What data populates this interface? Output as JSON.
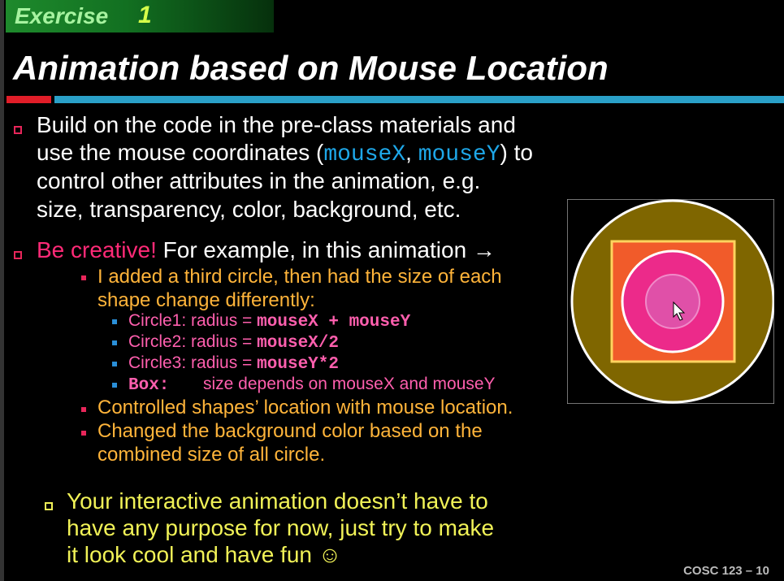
{
  "header": {
    "tag": "Exercise",
    "tag_number": "1",
    "title": "Animation based on Mouse Location"
  },
  "bullet1": {
    "line1": "Build on the code in the pre-class materials and",
    "line2_pre": "use the mouse coordinates (",
    "code1": "mouseX",
    "sep": ", ",
    "code2": "mouseY",
    "line2_post": ") to",
    "line3": "control other attributes in the animation, e.g.",
    "line4": "size, transparency, color, background, etc."
  },
  "bullet2": {
    "highlight": "Be creative!",
    "rest": " For example, in this animation →",
    "sub1_l1": "I added a third circle, then had the size of each",
    "sub1_l2": "shape change differently:",
    "items": [
      {
        "label": "Circle1:  radius = ",
        "code": "mouseX + mouseY"
      },
      {
        "label": "Circle2:  radius = ",
        "code": "mouseX/2"
      },
      {
        "label": "Circle3:  radius = ",
        "code": "mouseY*2"
      },
      {
        "label": "Box:",
        "code": "size depends on mouseX and mouseY"
      }
    ],
    "sub2": "Controlled shapes’ location with mouse location.",
    "sub3_l1": "Changed the background color based on the",
    "sub3_l2": "combined size of all circle."
  },
  "bullet3": {
    "line1": "Your interactive animation doesn’t have to",
    "line2": "have any purpose for now, just try to make",
    "line3": "it look cool and have fun ☺"
  },
  "footer": "COSC 123 – 10",
  "colors": {
    "accent_red": "#e01d28",
    "accent_teal": "#2aa0c8",
    "orange": "#ffb43a",
    "pink": "#ff5fae",
    "yellow": "#f1f257"
  }
}
